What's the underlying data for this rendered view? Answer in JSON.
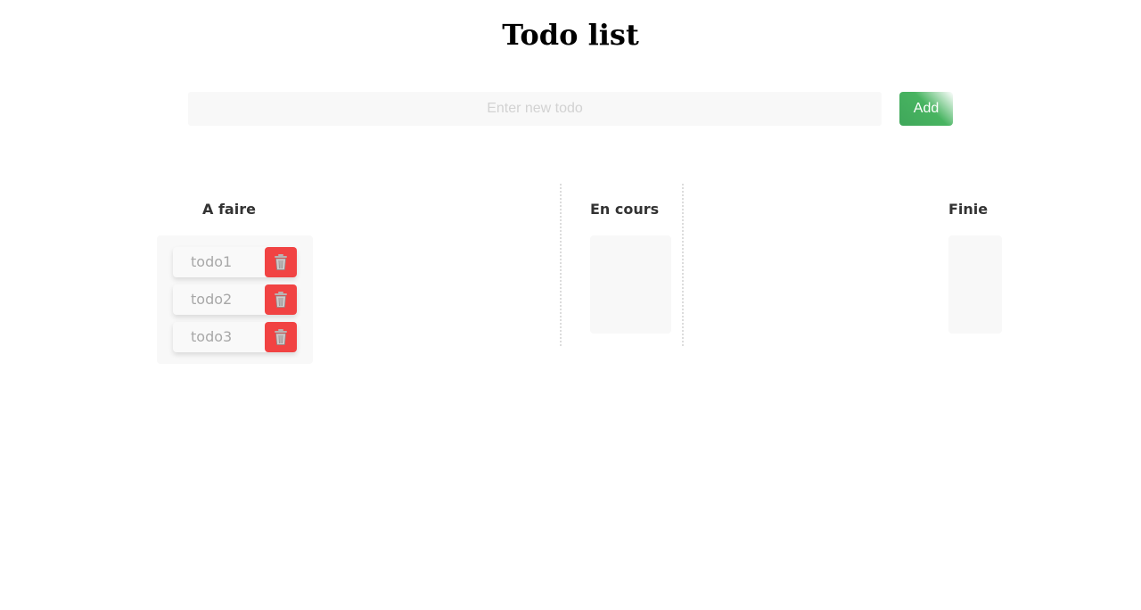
{
  "header": {
    "title": "Todo list"
  },
  "new_todo": {
    "placeholder": "Enter new todo",
    "value": "",
    "add_label": "Add",
    "add_color": "#48b461"
  },
  "columns": [
    {
      "title": "A faire",
      "items": [
        {
          "label": "todo1",
          "delete_icon": "trash-icon"
        },
        {
          "label": "todo2",
          "delete_icon": "trash-icon"
        },
        {
          "label": "todo3",
          "delete_icon": "trash-icon"
        }
      ]
    },
    {
      "title": "En cours",
      "items": []
    },
    {
      "title": "Finie",
      "items": []
    }
  ],
  "colors": {
    "delete": "#f14343",
    "zone_background": "#f8f8f8",
    "column_title": "#333333"
  }
}
